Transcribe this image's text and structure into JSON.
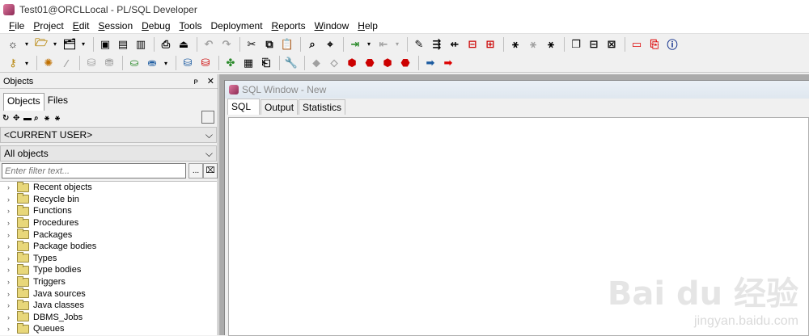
{
  "window": {
    "title": "Test01@ORCLLocal - PL/SQL Developer"
  },
  "menu": {
    "items": [
      {
        "u": "F",
        "rest": "ile"
      },
      {
        "u": "P",
        "rest": "roject"
      },
      {
        "u": "E",
        "rest": "dit"
      },
      {
        "u": "S",
        "rest": "ession"
      },
      {
        "u": "D",
        "rest": "ebug"
      },
      {
        "u": "T",
        "rest": "ools"
      },
      {
        "u": "",
        "rest": "Deployment"
      },
      {
        "u": "R",
        "rest": "eports"
      },
      {
        "u": "W",
        "rest": "indow"
      },
      {
        "u": "H",
        "rest": "elp"
      }
    ]
  },
  "icons": {
    "toolbar1": [
      "new-icon",
      "open-icon",
      "reopen-icon",
      "save-icon",
      "save-as-icon",
      "save-all-icon",
      "print-icon",
      "print-setup-icon",
      "undo-icon",
      "redo-icon",
      "cut-icon",
      "copy-icon",
      "paste-icon",
      "find-icon",
      "find-replace-icon",
      "indent-icon",
      "unindent-icon",
      "comment-icon",
      "uncomment-icon",
      "upper-icon",
      "lower-icon",
      "describe-icon",
      "query-icon",
      "explain-icon",
      "template-icon",
      "cascade-icon",
      "tile-icon",
      "help-icon",
      "oracle-icon",
      "pdf-icon",
      "info-icon"
    ]
  },
  "objects_panel": {
    "title": "Objects",
    "pin_glyph": "ᴘ",
    "close_glyph": "✕",
    "tabs": [
      "Objects",
      "Files"
    ],
    "user_combo": "<CURRENT USER>",
    "scope_combo": "All objects",
    "filter_placeholder": "Enter filter text...",
    "filter_button": "...",
    "tree": [
      "Recent objects",
      "Recycle bin",
      "Functions",
      "Procedures",
      "Packages",
      "Package bodies",
      "Types",
      "Type bodies",
      "Triggers",
      "Java sources",
      "Java classes",
      "DBMS_Jobs",
      "Queues"
    ]
  },
  "sql_window": {
    "title": "SQL Window - New",
    "tabs": [
      "SQL",
      "Output",
      "Statistics"
    ]
  },
  "watermark": {
    "logo": "Bai du 经验",
    "url": "jingyan.baidu.com"
  },
  "colors": {
    "accent": "#8c2a55",
    "workspace_bg": "#ababab"
  }
}
